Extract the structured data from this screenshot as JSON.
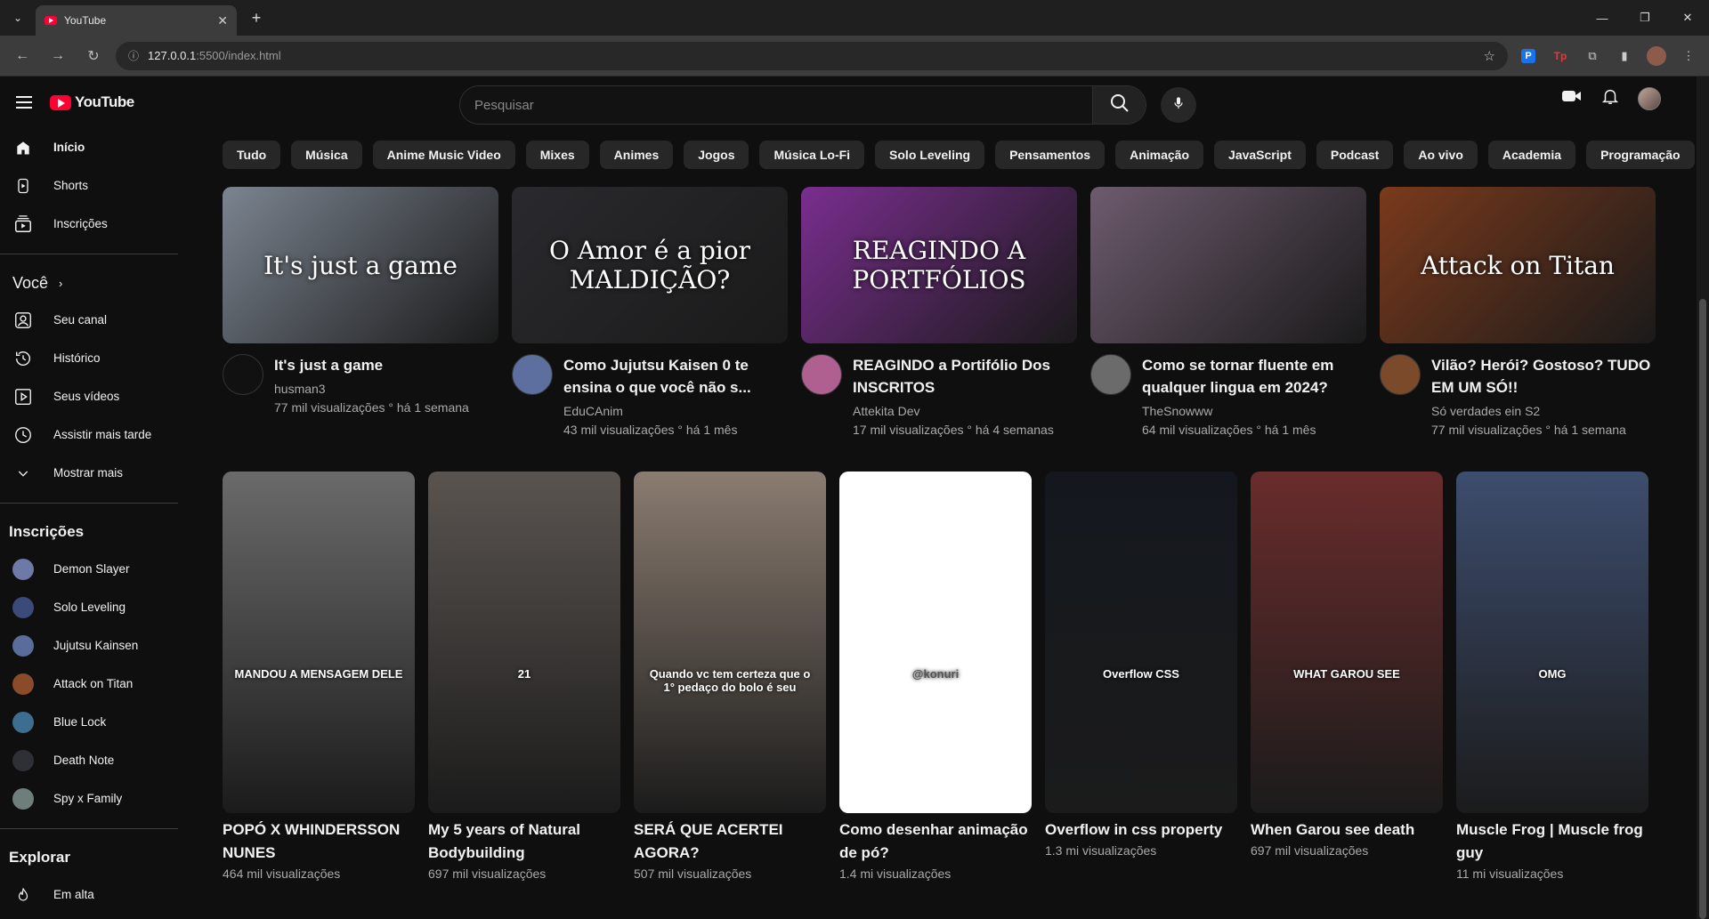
{
  "browser": {
    "tab_title": "YouTube",
    "url_host": "127.0.0.1",
    "url_path": ":5500/index.html",
    "accent": "#3c3c3c"
  },
  "yt": {
    "logo_text": "YouTube",
    "search_placeholder": "Pesquisar",
    "nav": [
      {
        "label": "Início",
        "icon": "home-icon"
      },
      {
        "label": "Shorts",
        "icon": "shorts-icon"
      },
      {
        "label": "Inscrições",
        "icon": "subscriptions-icon"
      }
    ],
    "voce_title": "Você",
    "voce_items": [
      {
        "label": "Seu canal",
        "icon": "channel-icon"
      },
      {
        "label": "Histórico",
        "icon": "history-icon"
      },
      {
        "label": "Seus vídeos",
        "icon": "your-videos-icon"
      },
      {
        "label": "Assistir mais tarde",
        "icon": "watch-later-icon"
      },
      {
        "label": "Mostrar mais",
        "icon": "chevron-down-icon"
      }
    ],
    "subs_title": "Inscrições",
    "subs": [
      {
        "label": "Demon Slayer",
        "color": "#6d7aa8"
      },
      {
        "label": "Solo Leveling",
        "color": "#3b4a78"
      },
      {
        "label": "Jujutsu Kainsen",
        "color": "#5a6d9a"
      },
      {
        "label": "Attack on Titan",
        "color": "#8a4b2a"
      },
      {
        "label": "Blue Lock",
        "color": "#3d6e8f"
      },
      {
        "label": "Death Note",
        "color": "#2e3036"
      },
      {
        "label": "Spy x Family",
        "color": "#6e7e7a"
      }
    ],
    "explore_title": "Explorar",
    "explore_items": [
      {
        "label": "Em alta",
        "icon": "trending-icon"
      }
    ],
    "chips": [
      "Tudo",
      "Música",
      "Anime Music Video",
      "Mixes",
      "Animes",
      "Jogos",
      "Música Lo-Fi",
      "Solo Leveling",
      "Pensamentos",
      "Animação",
      "JavaScript",
      "Podcast",
      "Ao vivo",
      "Academia",
      "Programação"
    ],
    "videos": [
      {
        "title": "It's just a game",
        "channel": "husman3",
        "stats": "77 mil visualizações ° há 1 semana",
        "thumb_text": "It's just a game",
        "bg": "#7b8490",
        "avatar": "#111111"
      },
      {
        "title": "Como Jujutsu Kaisen 0 te ensina o que você não s...",
        "channel": "EduCAnim",
        "stats": "43 mil visualizações ° há 1 mês",
        "thumb_text": "O Amor é a pior MALDIÇÃO?",
        "bg": "#2a2a2e",
        "avatar": "#5c6f9e"
      },
      {
        "title": "REAGINDO a Portifólio Dos INSCRITOS",
        "channel": "Attekita Dev",
        "stats": "17 mil visualizações ° há 4 semanas",
        "thumb_text": "REAGINDO A PORTFÓLIOS",
        "bg": "#7a2e8f",
        "avatar": "#b06090"
      },
      {
        "title": "Como se tornar fluente em qualquer lingua em 2024?",
        "channel": "TheSnowww",
        "stats": "64 mil visualizações ° há 1 mês",
        "thumb_text": "",
        "bg": "#6d5b6e",
        "avatar": "#6b6b6b"
      },
      {
        "title": "Vilão? Herói? Gostoso? TUDO EM UM SÓ!!",
        "channel": "Só verdades ein S2",
        "stats": "77 mil visualizações ° há 1 semana",
        "thumb_text": "Attack on Titan",
        "bg": "#7a3a1c",
        "avatar": "#7a4a2a"
      }
    ],
    "shorts": [
      {
        "title": "POPÓ X WHINDERSSON NUNES",
        "views": "464 mil visualizações",
        "caption": "MANDOU A MENSAGEM DELE",
        "bg": "#6b6a6a"
      },
      {
        "title": "My 5 years of Natural Bodybuilding",
        "views": "697 mil visualizações",
        "caption": "21",
        "bg": "#5a5450"
      },
      {
        "title": "SERÁ QUE ACERTEI AGORA?",
        "views": "507 mil visualizações",
        "caption": "Quando vc tem certeza que o 1° pedaço do bolo é seu",
        "bg": "#8a7c70"
      },
      {
        "title": "Como desenhar animação de pó?",
        "views": "1.4 mi visualizações",
        "caption": "@konuri",
        "bg": "#ffffff"
      },
      {
        "title": "Overflow in css property",
        "views": "1.3 mi visualizações",
        "caption": "Overflow CSS",
        "bg": "#14181e"
      },
      {
        "title": "When Garou see death",
        "views": "697 mil visualizações",
        "caption": "WHAT GAROU SEE",
        "bg": "#6a2c2c"
      },
      {
        "title": "Muscle Frog | Muscle frog guy",
        "views": "11 mi visualizações",
        "caption": "OMG",
        "bg": "#3d4d6e"
      }
    ]
  }
}
